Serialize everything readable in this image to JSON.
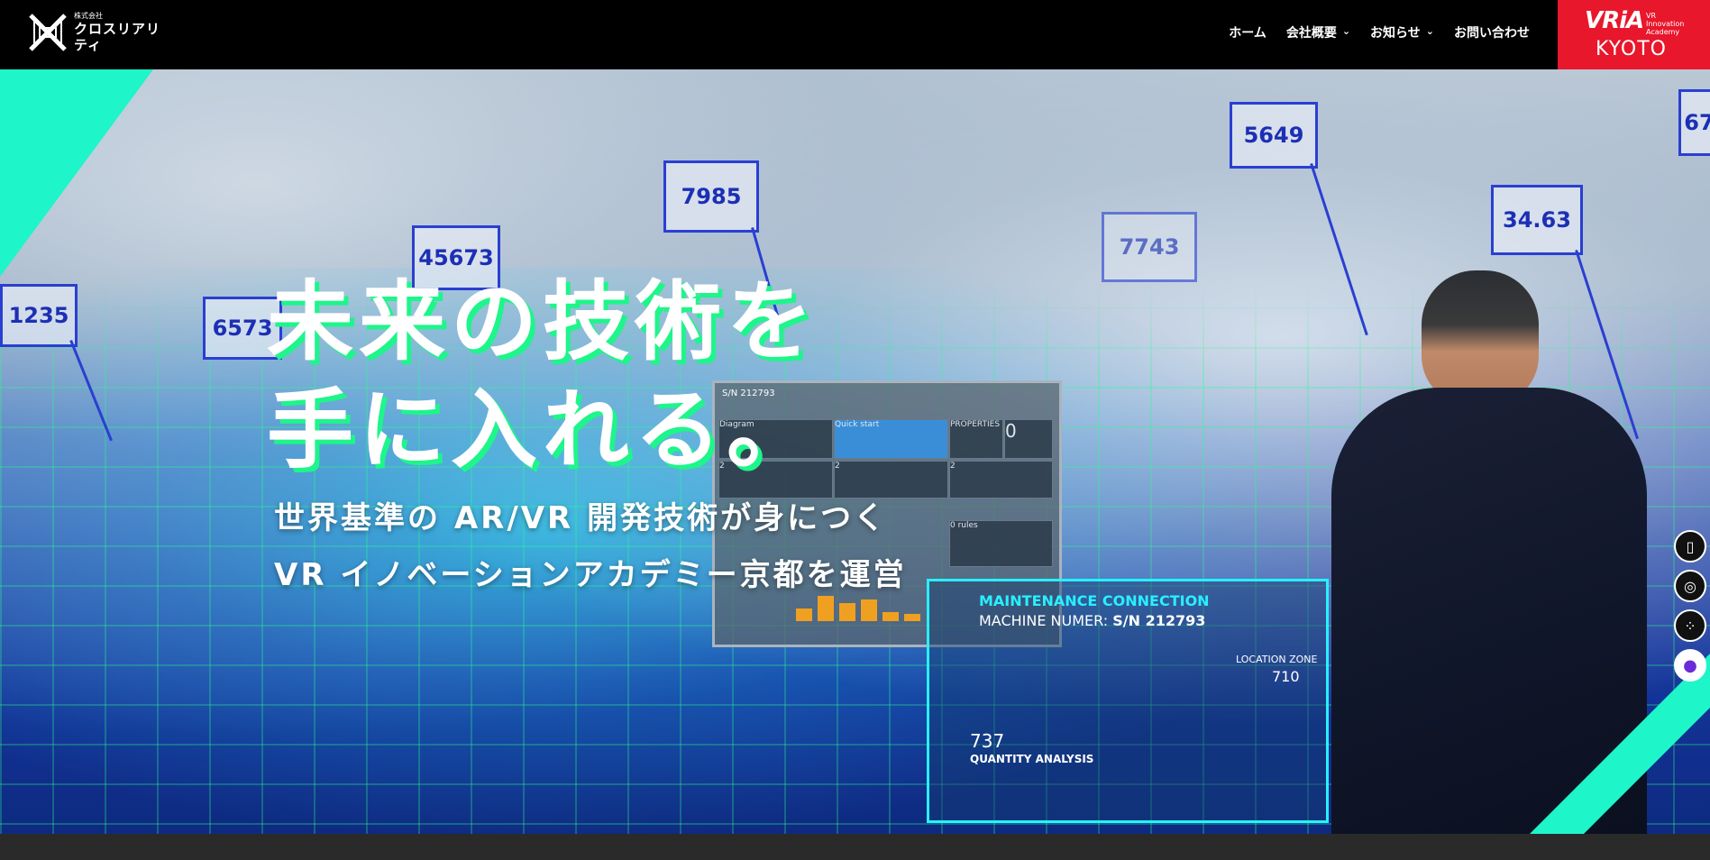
{
  "header": {
    "logo": {
      "small": "株式会社",
      "name": "クロスリアリティ",
      "icon": "xr-logo-icon"
    },
    "nav": [
      {
        "label": "ホーム",
        "has_dropdown": false
      },
      {
        "label": "会社概要",
        "has_dropdown": true
      },
      {
        "label": "お知らせ",
        "has_dropdown": true
      },
      {
        "label": "お問い合わせ",
        "has_dropdown": false
      }
    ],
    "badge": {
      "logo": "VRiA",
      "sub": "VR\nInnovation\nAcademy",
      "city": "KYOTO",
      "color": "#e8172c"
    }
  },
  "hero": {
    "headline_line1": "未来の技術を",
    "headline_line2": "手に入れる。",
    "subline1": "世界基準の AR/VR 開発技術が身につく",
    "subline2": "VR イノベーションアカデミー京都を運営",
    "tags": [
      "1235",
      "6573",
      "45673",
      "7985",
      "5649",
      "34.63",
      "7743",
      "67"
    ],
    "panel": {
      "title": "S/N 212793",
      "cells": [
        "Diagram",
        "Quick start",
        "PROPERTIES",
        "0",
        "TAGS",
        "2",
        "2",
        "2",
        "0 rules"
      ]
    },
    "maintenance": {
      "title": "MAINTENANCE CONNECTION",
      "machine": "MACHINE NUMER:",
      "serial": "S/N 212793",
      "quantity": "737",
      "quantity_label": "QUANTITY ANALYSIS",
      "location": "LOCATION ZONE",
      "location_value": "710"
    }
  },
  "side_icons": [
    "book-icon",
    "podcast-icon",
    "grid-icon",
    "bot-icon"
  ],
  "colors": {
    "accent": "#1ef5c9",
    "headline_shadow": "#1ef58a",
    "tag": "#2a3fd1"
  }
}
